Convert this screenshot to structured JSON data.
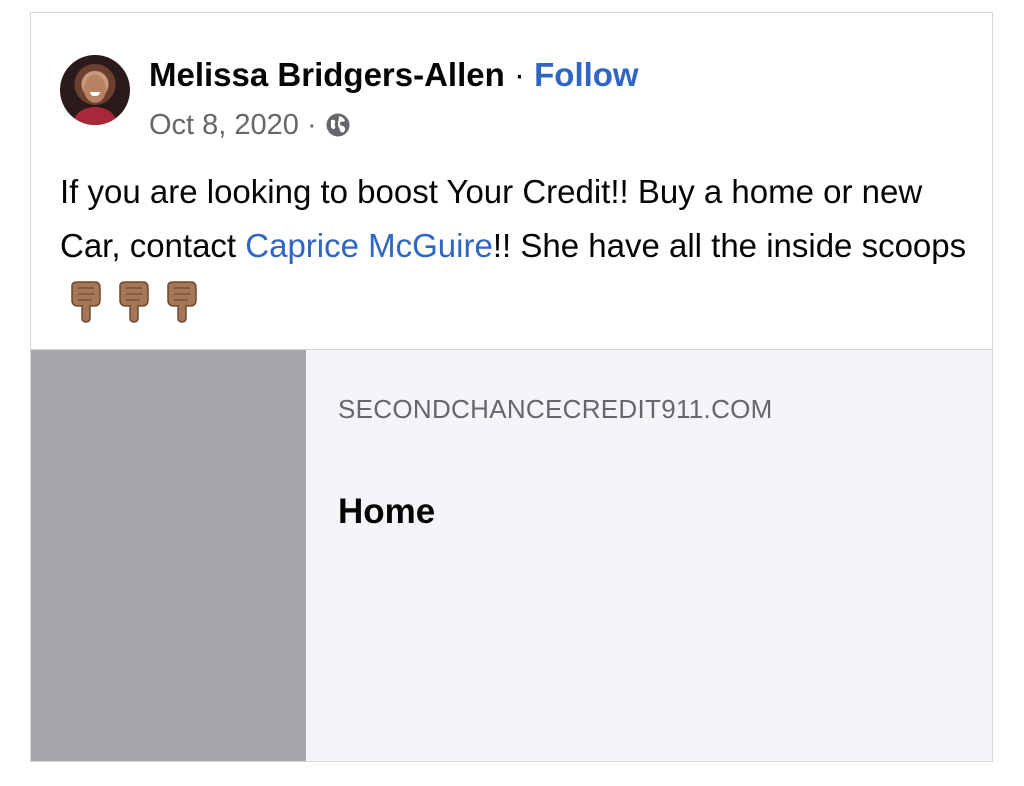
{
  "post": {
    "author_name": "Melissa Bridgers-Allen",
    "separator": "·",
    "follow_label": "Follow",
    "date": "Oct 8, 2020",
    "meta_separator": "·",
    "privacy_icon": "globe-icon",
    "text_part1": "If you are looking to boost Your Credit!! Buy a home or new Car, contact ",
    "mention": "Caprice McGuire",
    "text_part2": "!! She have all the inside scoops",
    "emojis": [
      "pointing-down-hand-icon",
      "pointing-down-hand-icon",
      "pointing-down-hand-icon"
    ]
  },
  "link_preview": {
    "domain": "SECONDCHANCECREDIT911.COM",
    "title": "Home"
  },
  "colors": {
    "link_blue": "#2f66c6",
    "meta_gray": "#65676b",
    "preview_bg": "#f4f5f8",
    "preview_image_gray": "#a6a7ab",
    "skin_tone": "#a57756"
  }
}
